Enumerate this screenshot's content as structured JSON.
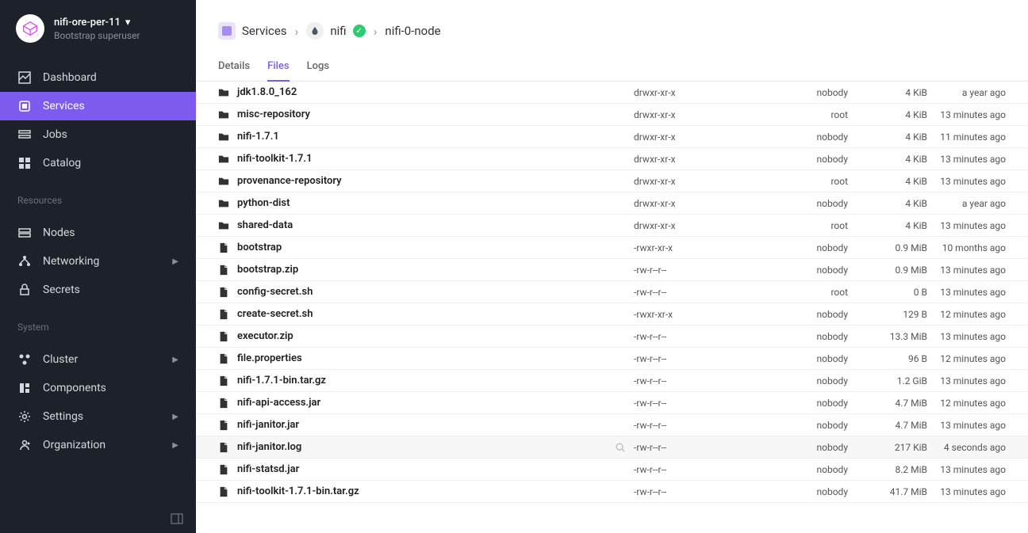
{
  "header": {
    "project": "nifi-ore-per-11",
    "role": "Bootstrap superuser"
  },
  "nav": {
    "main": [
      {
        "icon": "dashboard",
        "label": "Dashboard"
      },
      {
        "icon": "services",
        "label": "Services",
        "active": true
      },
      {
        "icon": "jobs",
        "label": "Jobs"
      },
      {
        "icon": "catalog",
        "label": "Catalog"
      }
    ],
    "resources_label": "Resources",
    "resources": [
      {
        "icon": "nodes",
        "label": "Nodes"
      },
      {
        "icon": "networking",
        "label": "Networking",
        "expandable": true
      },
      {
        "icon": "secrets",
        "label": "Secrets"
      }
    ],
    "system_label": "System",
    "system": [
      {
        "icon": "cluster",
        "label": "Cluster",
        "expandable": true
      },
      {
        "icon": "components",
        "label": "Components"
      },
      {
        "icon": "settings",
        "label": "Settings",
        "expandable": true
      },
      {
        "icon": "organization",
        "label": "Organization",
        "expandable": true
      }
    ]
  },
  "breadcrumb": {
    "root": "Services",
    "service": "nifi",
    "node": "nifi-0-node"
  },
  "tabs": {
    "details": "Details",
    "files": "Files",
    "logs": "Logs"
  },
  "files": [
    {
      "type": "folder",
      "name": "jdk1.8.0_162",
      "perm": "drwxr-xr-x",
      "owner": "nobody",
      "size": "4 KiB",
      "time": "a year ago"
    },
    {
      "type": "folder",
      "name": "misc-repository",
      "perm": "drwxr-xr-x",
      "owner": "root",
      "size": "4 KiB",
      "time": "13 minutes ago"
    },
    {
      "type": "folder",
      "name": "nifi-1.7.1",
      "perm": "drwxr-xr-x",
      "owner": "nobody",
      "size": "4 KiB",
      "time": "11 minutes ago"
    },
    {
      "type": "folder",
      "name": "nifi-toolkit-1.7.1",
      "perm": "drwxr-xr-x",
      "owner": "nobody",
      "size": "4 KiB",
      "time": "13 minutes ago"
    },
    {
      "type": "folder",
      "name": "provenance-repository",
      "perm": "drwxr-xr-x",
      "owner": "root",
      "size": "4 KiB",
      "time": "13 minutes ago"
    },
    {
      "type": "folder",
      "name": "python-dist",
      "perm": "drwxr-xr-x",
      "owner": "nobody",
      "size": "4 KiB",
      "time": "a year ago"
    },
    {
      "type": "folder",
      "name": "shared-data",
      "perm": "drwxr-xr-x",
      "owner": "root",
      "size": "4 KiB",
      "time": "13 minutes ago"
    },
    {
      "type": "file",
      "name": "bootstrap",
      "perm": "-rwxr-xr-x",
      "owner": "nobody",
      "size": "0.9 MiB",
      "time": "10 months ago"
    },
    {
      "type": "file",
      "name": "bootstrap.zip",
      "perm": "-rw-r--r--",
      "owner": "nobody",
      "size": "0.9 MiB",
      "time": "13 minutes ago"
    },
    {
      "type": "file",
      "name": "config-secret.sh",
      "perm": "-rw-r--r--",
      "owner": "root",
      "size": "0 B",
      "time": "13 minutes ago"
    },
    {
      "type": "file",
      "name": "create-secret.sh",
      "perm": "-rwxr-xr-x",
      "owner": "nobody",
      "size": "129 B",
      "time": "12 minutes ago"
    },
    {
      "type": "file",
      "name": "executor.zip",
      "perm": "-rw-r--r--",
      "owner": "nobody",
      "size": "13.3 MiB",
      "time": "13 minutes ago"
    },
    {
      "type": "file",
      "name": "file.properties",
      "perm": "-rw-r--r--",
      "owner": "nobody",
      "size": "96 B",
      "time": "12 minutes ago"
    },
    {
      "type": "file",
      "name": "nifi-1.7.1-bin.tar.gz",
      "perm": "-rw-r--r--",
      "owner": "nobody",
      "size": "1.2 GiB",
      "time": "13 minutes ago"
    },
    {
      "type": "file",
      "name": "nifi-api-access.jar",
      "perm": "-rw-r--r--",
      "owner": "nobody",
      "size": "4.7 MiB",
      "time": "12 minutes ago"
    },
    {
      "type": "file",
      "name": "nifi-janitor.jar",
      "perm": "-rw-r--r--",
      "owner": "nobody",
      "size": "4.7 MiB",
      "time": "13 minutes ago"
    },
    {
      "type": "file",
      "name": "nifi-janitor.log",
      "perm": "-rw-r--r--",
      "owner": "nobody",
      "size": "217 KiB",
      "time": "4 seconds ago",
      "hover": true
    },
    {
      "type": "file",
      "name": "nifi-statsd.jar",
      "perm": "-rw-r--r--",
      "owner": "nobody",
      "size": "8.2 MiB",
      "time": "13 minutes ago"
    },
    {
      "type": "file",
      "name": "nifi-toolkit-1.7.1-bin.tar.gz",
      "perm": "-rw-r--r--",
      "owner": "nobody",
      "size": "41.7 MiB",
      "time": "13 minutes ago"
    }
  ]
}
